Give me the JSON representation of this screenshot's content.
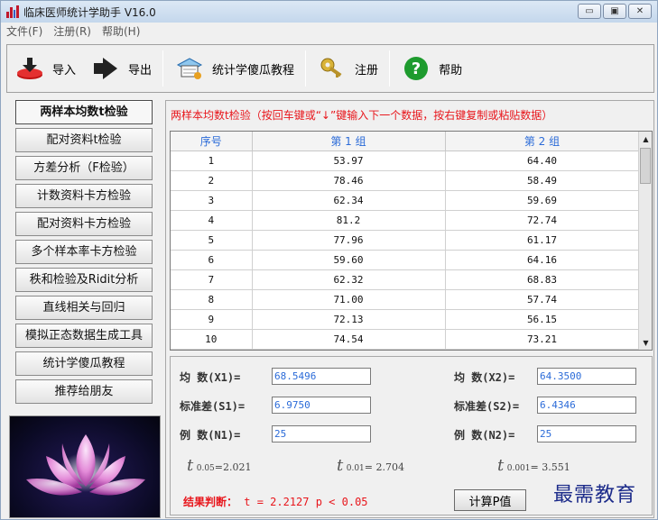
{
  "window": {
    "title": "临床医师统计学助手 V16.0",
    "controls": [
      "▭",
      "▣",
      "✕"
    ]
  },
  "menu": [
    {
      "label": "文件(F)"
    },
    {
      "label": "注册(R)"
    },
    {
      "label": "帮助(H)"
    }
  ],
  "toolbar": {
    "import_label": "导入",
    "export_label": "导出",
    "tutorial_label": "统计学傻瓜教程",
    "register_label": "注册",
    "help_label": "帮助"
  },
  "nav": [
    {
      "label": "两样本均数t检验",
      "active": true
    },
    {
      "label": "配对资料t检验"
    },
    {
      "label": "方差分析（F检验）"
    },
    {
      "label": "计数资料卡方检验"
    },
    {
      "label": "配对资料卡方检验"
    },
    {
      "label": "多个样本率卡方检验"
    },
    {
      "label": "秩和检验及Ridit分析"
    },
    {
      "label": "直线相关与回归"
    },
    {
      "label": "模拟正态数据生成工具"
    },
    {
      "label": "统计学傻瓜教程"
    },
    {
      "label": "推荐给朋友"
    }
  ],
  "main": {
    "hint": "两样本均数t检验（按回车键或“↓”键输入下一个数据，按右键复制或粘贴数据）",
    "table": {
      "headers": [
        "序号",
        "第 1 组",
        "第 2 组"
      ],
      "rows": [
        [
          "1",
          "53.97",
          "64.40"
        ],
        [
          "2",
          "78.46",
          "58.49"
        ],
        [
          "3",
          "62.34",
          "59.69"
        ],
        [
          "4",
          "81.2",
          "72.74"
        ],
        [
          "5",
          "77.96",
          "61.17"
        ],
        [
          "6",
          "59.60",
          "64.16"
        ],
        [
          "7",
          "62.32",
          "68.83"
        ],
        [
          "8",
          "71.00",
          "57.74"
        ],
        [
          "9",
          "72.13",
          "56.15"
        ],
        [
          "10",
          "74.54",
          "73.21"
        ]
      ]
    },
    "stats": {
      "mean1_label": "均  数(X1)=",
      "mean1": "68.5496",
      "mean2_label": "均  数(X2)=",
      "mean2": "64.3500",
      "sd1_label": "标准差(S1)=",
      "sd1": "6.9750",
      "sd2_label": "标准差(S2)=",
      "sd2": "6.4346",
      "n1_label": "例  数(N1)=",
      "n1": "25",
      "n2_label": "例  数(N2)=",
      "n2": "25",
      "t005_sub": "0.05",
      "t005_val": "=2.021",
      "t001_sub": "0.01",
      "t001_val": "= 2.704",
      "t0001_sub": "0.001",
      "t0001_val": "= 3.551",
      "result_label": "结果判断：",
      "result_value": "t = 2.2127  p < 0.05",
      "calc_button": "计算P值"
    }
  },
  "watermark": "最需教育"
}
